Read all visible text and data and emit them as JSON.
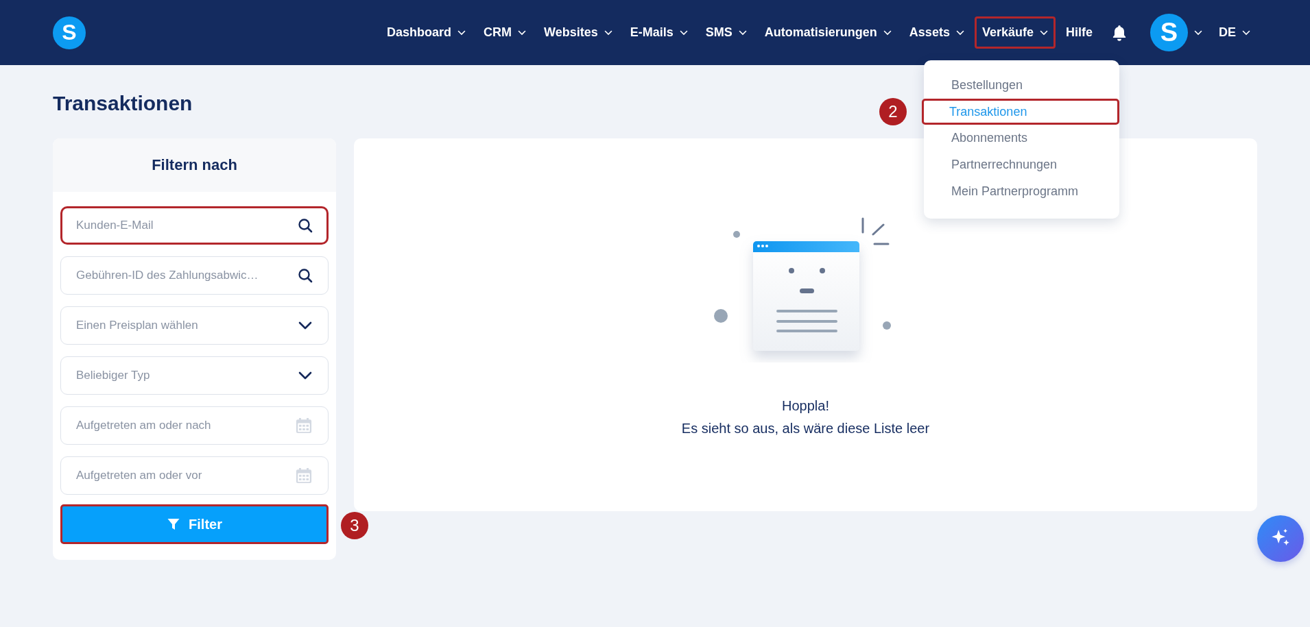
{
  "logo": {
    "letter": "S"
  },
  "nav": [
    {
      "label": "Dashboard",
      "dropdown": true,
      "highlighted": false
    },
    {
      "label": "CRM",
      "dropdown": true,
      "highlighted": false
    },
    {
      "label": "Websites",
      "dropdown": true,
      "highlighted": false
    },
    {
      "label": "E-Mails",
      "dropdown": true,
      "highlighted": false
    },
    {
      "label": "SMS",
      "dropdown": true,
      "highlighted": false
    },
    {
      "label": "Automatisierungen",
      "dropdown": true,
      "highlighted": false
    },
    {
      "label": "Assets",
      "dropdown": true,
      "highlighted": false
    },
    {
      "label": "Verkäufe",
      "dropdown": true,
      "highlighted": true
    },
    {
      "label": "Hilfe",
      "dropdown": false,
      "highlighted": false
    }
  ],
  "avatar": {
    "letter": "S"
  },
  "language": "DE",
  "nav_menu": {
    "items": [
      {
        "label": "Bestellungen",
        "selected": false,
        "highlighted": false
      },
      {
        "label": "Transaktionen",
        "selected": true,
        "highlighted": true,
        "step": "2"
      },
      {
        "label": "Abonnements",
        "selected": false,
        "highlighted": false
      },
      {
        "label": "Partnerrechnungen",
        "selected": false,
        "highlighted": false
      },
      {
        "label": "Mein Partnerprogramm",
        "selected": false,
        "highlighted": false
      }
    ]
  },
  "page_title": "Transaktionen",
  "filter": {
    "title": "Filtern nach",
    "fields": [
      {
        "kind": "search",
        "placeholder": "Kunden-E-Mail",
        "highlighted": true
      },
      {
        "kind": "search",
        "placeholder": "Gebühren-ID des Zahlungsabwic…",
        "highlighted": false
      },
      {
        "kind": "select",
        "placeholder": "Einen Preisplan wählen",
        "highlighted": false
      },
      {
        "kind": "select",
        "placeholder": "Beliebiger Typ",
        "highlighted": false
      },
      {
        "kind": "date",
        "placeholder": "Aufgetreten am oder nach",
        "highlighted": false
      },
      {
        "kind": "date",
        "placeholder": "Aufgetreten am oder vor",
        "highlighted": false
      }
    ],
    "button": {
      "label": "Filter",
      "highlighted": true,
      "step": "3"
    }
  },
  "empty_state": {
    "title": "Hoppla!",
    "message": "Es sieht so aus, als wäre diese Liste leer"
  }
}
